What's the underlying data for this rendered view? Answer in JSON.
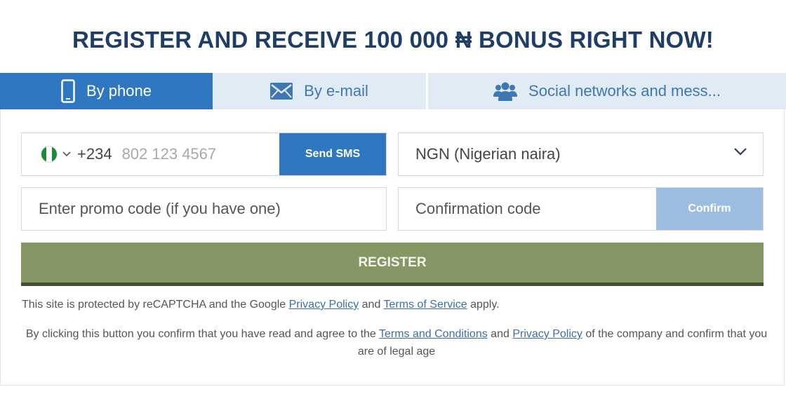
{
  "page_title": "REGISTER AND RECEIVE 100 000 ₦ BONUS RIGHT NOW!",
  "tabs": [
    {
      "label": "By phone",
      "icon": "phone-icon",
      "active": true
    },
    {
      "label": "By e-mail",
      "icon": "mail-icon",
      "active": false
    },
    {
      "label": "Social networks and mess...",
      "icon": "users-icon",
      "active": false
    }
  ],
  "phone": {
    "flag": "nigeria-flag-icon",
    "country_code": "+234",
    "placeholder": "802 123 4567",
    "send_sms_label": "Send SMS"
  },
  "currency": {
    "selected": "NGN (Nigerian naira)"
  },
  "promo": {
    "placeholder": "Enter promo code (if you have one)"
  },
  "confirmation": {
    "placeholder": "Confirmation code",
    "confirm_label": "Confirm"
  },
  "register_label": "REGISTER",
  "recaptcha": {
    "prefix": "This site is protected by reCAPTCHA and the Google ",
    "privacy_link": "Privacy Policy",
    "and": " and ",
    "terms_link": "Terms of Service",
    "suffix": " apply."
  },
  "agreement": {
    "prefix": "By clicking this button you confirm that you have read and agree to the ",
    "terms_link": "Terms and Conditions",
    "and": " and ",
    "privacy_link": "Privacy Policy",
    "suffix": " of the company and confirm that you are of legal age"
  },
  "colors": {
    "title": "#1f3e66",
    "primary": "#2f77c0",
    "tab_background": "#e1ebf5",
    "register": "#869664",
    "confirm_disabled": "#9dbde0"
  }
}
